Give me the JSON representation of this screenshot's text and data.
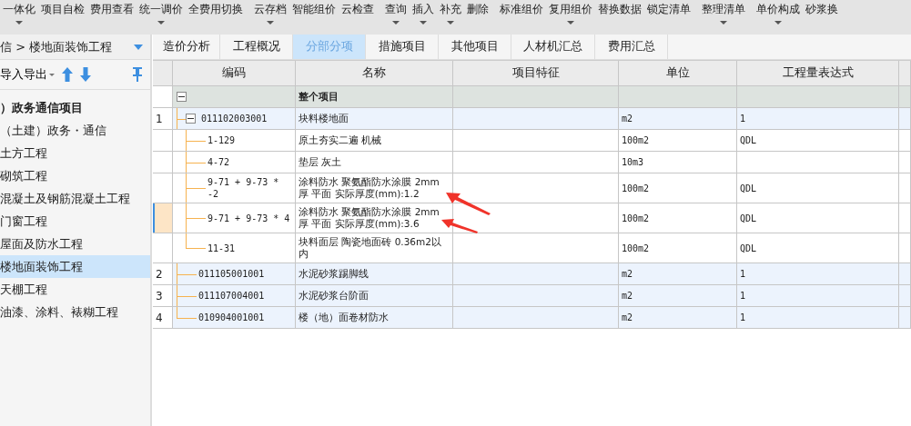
{
  "toolbar": [
    {
      "label": "一体化",
      "dropdown": true
    },
    {
      "label": "项目自检",
      "dropdown": false
    },
    {
      "label": "费用查看",
      "dropdown": false
    },
    {
      "label": "统一调价",
      "dropdown": true
    },
    {
      "label": "全费用切换",
      "dropdown": false
    },
    {
      "label": "云存档",
      "dropdown": true
    },
    {
      "label": "智能组价",
      "dropdown": false
    },
    {
      "label": "云检查",
      "dropdown": false
    },
    {
      "label": "查询",
      "dropdown": true
    },
    {
      "label": "插入",
      "dropdown": true
    },
    {
      "label": "补充",
      "dropdown": true
    },
    {
      "label": "删除",
      "dropdown": false
    },
    {
      "label": "标准组价",
      "dropdown": false
    },
    {
      "label": "复用组价",
      "dropdown": true
    },
    {
      "label": "替换数据",
      "dropdown": false
    },
    {
      "label": "锁定清单",
      "dropdown": false
    },
    {
      "label": "整理清单",
      "dropdown": true
    },
    {
      "label": "单价构成",
      "dropdown": true
    },
    {
      "label": "砂浆换",
      "dropdown": false
    }
  ],
  "sidebar": {
    "breadcrumb": "信 > 楼地面装饰工程",
    "import_export": "导入导出",
    "items": [
      {
        "label": "）政务通信项目",
        "selected": false,
        "children": [
          {
            "label": "（土建）政务・通信",
            "selected": false
          },
          {
            "label": "土方工程",
            "selected": false
          },
          {
            "label": "砌筑工程",
            "selected": false
          },
          {
            "label": "混凝土及钢筋混凝土工程",
            "selected": false
          },
          {
            "label": "门窗工程",
            "selected": false
          },
          {
            "label": "屋面及防水工程",
            "selected": false
          },
          {
            "label": "楼地面装饰工程",
            "selected": true
          },
          {
            "label": "天棚工程",
            "selected": false
          },
          {
            "label": "油漆、涂料、裱糊工程",
            "selected": false
          }
        ]
      }
    ]
  },
  "tabs": [
    {
      "label": "造价分析",
      "selected": false
    },
    {
      "label": "工程概况",
      "selected": false
    },
    {
      "label": "分部分项",
      "selected": true
    },
    {
      "label": "措施项目",
      "selected": false
    },
    {
      "label": "其他项目",
      "selected": false
    },
    {
      "label": "人材机汇总",
      "selected": false
    },
    {
      "label": "费用汇总",
      "selected": false
    }
  ],
  "table": {
    "columns": [
      "编码",
      "名称",
      "项目特征",
      "单位",
      "工程量表达式"
    ],
    "rows": [
      {
        "kind": "whole",
        "name": "整个项目",
        "expanded": true,
        "selected": false,
        "children": [
          {
            "kind": "item",
            "number": "1",
            "code": "011102003001",
            "name": "块料楼地面",
            "unit": "m2",
            "expression": "1",
            "expanded": true,
            "selected": false,
            "children": [
              {
                "kind": "quota",
                "code": "1-129",
                "name": "原土夯实二遍 机械",
                "unit": "100m2",
                "expression": "QDL",
                "selected": false
              },
              {
                "kind": "quota",
                "code": "4-72",
                "name": "垫层 灰土",
                "unit": "10m3",
                "selected": false
              },
              {
                "kind": "quota",
                "code": "9-71 + 9-73 * -2",
                "name": "涂料防水 聚氨酯防水涂膜 2mm厚 平面  实际厚度(mm):1.2",
                "unit": "100m2",
                "expression": "QDL",
                "selected": false
              },
              {
                "kind": "quota",
                "code": "9-71 + 9-73 * 4",
                "name": "涂料防水 聚氨酯防水涂膜 2mm厚 平面  实际厚度(mm):3.6",
                "unit": "100m2",
                "expression": "QDL",
                "selected": true
              },
              {
                "kind": "quota",
                "code": "11-31",
                "name": "块料面层 陶瓷地面砖 0.36m2以内",
                "unit": "100m2",
                "expression": "QDL",
                "selected": false
              }
            ]
          },
          {
            "kind": "item",
            "number": "2",
            "code": "011105001001",
            "name": "水泥砂浆踢脚线",
            "unit": "m2",
            "expression": "1",
            "selected": false
          },
          {
            "kind": "item",
            "number": "3",
            "code": "011107004001",
            "name": "水泥砂浆台阶面",
            "unit": "m2",
            "expression": "1",
            "selected": false
          },
          {
            "kind": "item",
            "number": "4",
            "code": "010904001001",
            "name": "楼（地）面卷材防水",
            "unit": "m2",
            "expression": "1",
            "selected": false
          }
        ]
      }
    ]
  }
}
